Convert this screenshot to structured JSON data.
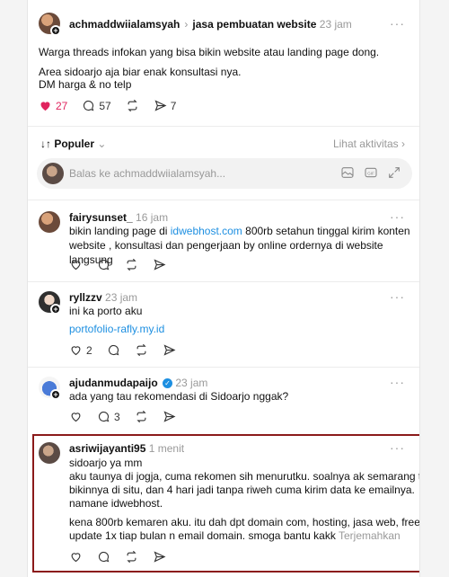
{
  "op": {
    "username": "achmaddwiialamsyah",
    "topic": "jasa pembuatan website",
    "time": "23 jam",
    "line1": "Warga threads infokan yang bisa bikin website atau landing page dong.",
    "line2": "Area sidoarjo aja biar enak konsultasi nya.",
    "line3": "DM harga & no telp",
    "likes": "27",
    "replies": "57",
    "shares": "7"
  },
  "sort": {
    "label": "↓↑ Populer",
    "activity": "Lihat aktivitas"
  },
  "reply_box": {
    "placeholder": "Balas ke achmaddwiialamsyah..."
  },
  "comments": [
    {
      "username": "fairysunset_",
      "time": "16 jam",
      "text_a": "bikin landing page di ",
      "link": "idwebhost.com",
      "text_b": " 800rb setahun tinggal kirim konten",
      "text_c": "website , konsultasi dan pengerjaan by online ordernya di website langsung"
    },
    {
      "username": "ryllzzv",
      "time": "23 jam",
      "text": "ini ka porto aku",
      "link": "portofolio-rafly.my.id",
      "likes": "2"
    },
    {
      "username": "ajudanmudapaijo",
      "time": "23 jam",
      "text": "ada yang tau rekomendasi di Sidoarjo nggak?",
      "replies": "3"
    },
    {
      "username": "asriwijayanti95",
      "time": "1 menit",
      "l1": "sidoarjo ya mm",
      "l2": "aku taunya di jogja, cuma rekomen sih menurutku. soalnya ak semarang tapi",
      "l3": "bikinnya di situ, dan 4 hari jadi tanpa riweh cuma kirim data ke emailnya.",
      "l4": "namane idwebhost.",
      "l5": "kena 800rb kemaren aku. itu dah dpt domain com, hosting, jasa web, free",
      "l6": "update 1x tiap bulan n email domain. smoga bantu kakk",
      "translate": "Terjemahkan"
    }
  ],
  "colors": {
    "accent": "#1d8fe1",
    "like": "#e0245e",
    "highlight": "#8b1a1a"
  }
}
